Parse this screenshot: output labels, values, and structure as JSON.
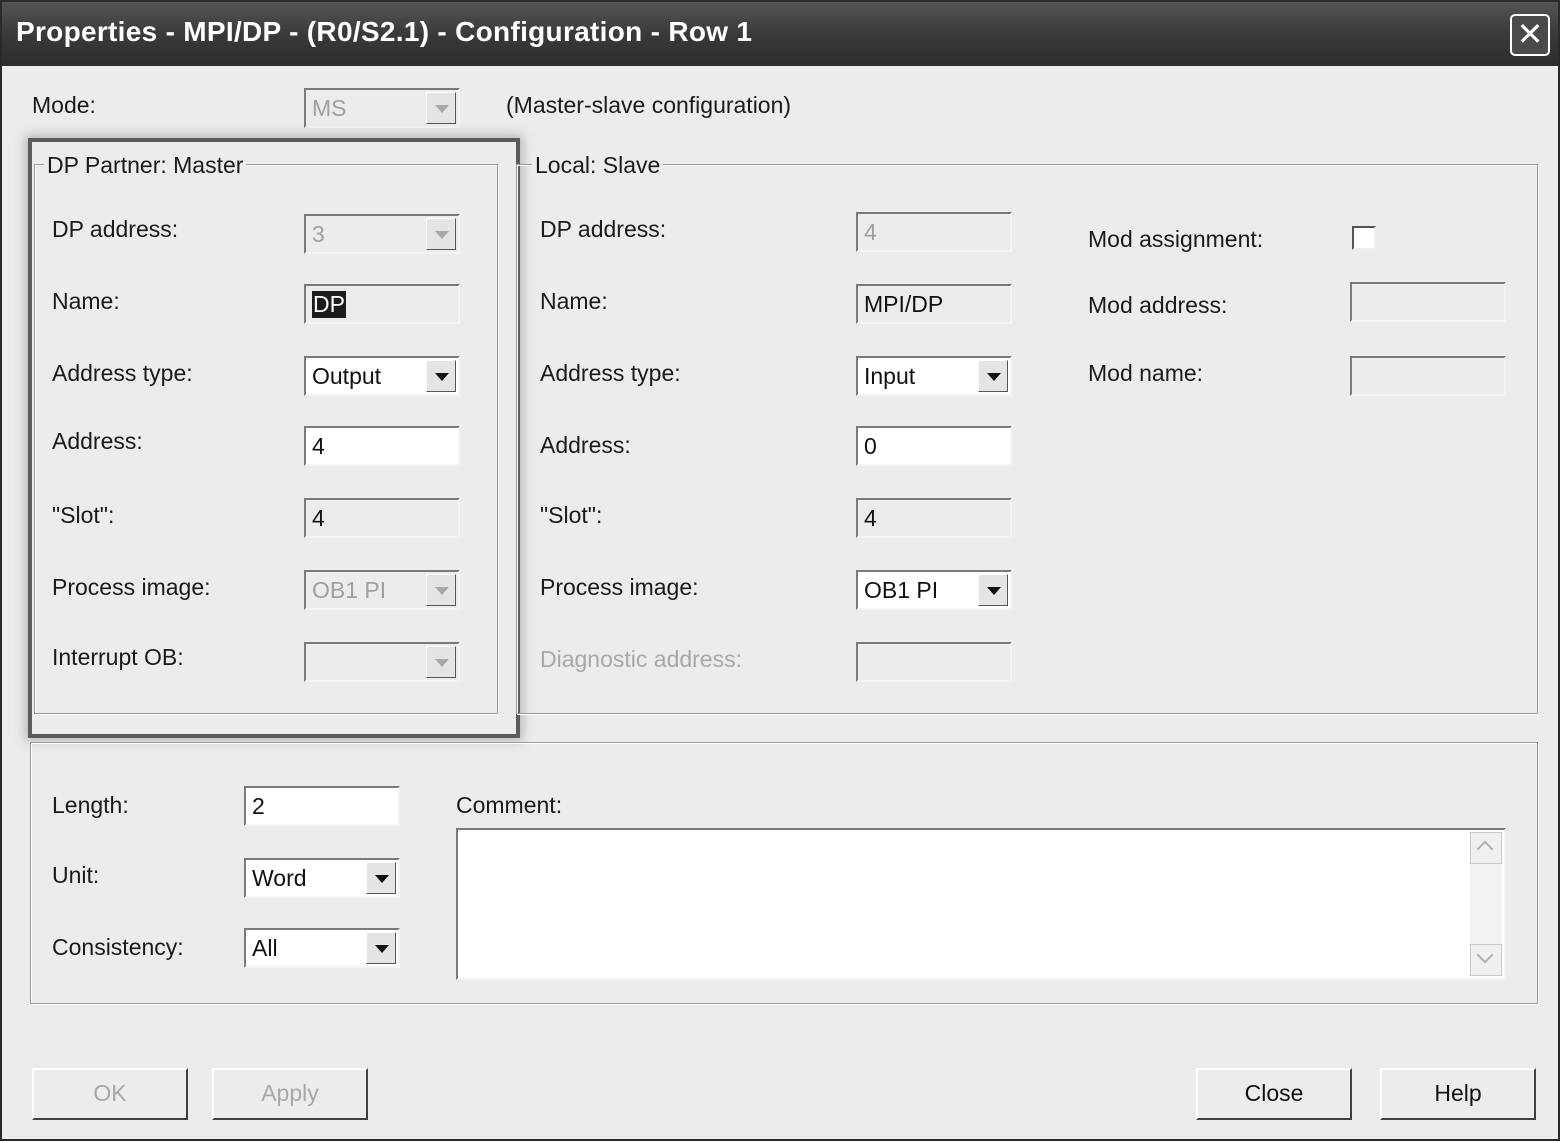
{
  "window": {
    "title": "Properties - MPI/DP - (R0/S2.1) - Configuration - Row 1",
    "close_glyph": "✕"
  },
  "mode": {
    "label": "Mode:",
    "value": "MS",
    "description": "(Master-slave configuration)"
  },
  "dp_partner": {
    "group_title": "DP Partner: Master",
    "dp_address_label": "DP address:",
    "dp_address_value": "3",
    "name_label": "Name:",
    "name_value": "DP",
    "address_type_label": "Address type:",
    "address_type_value": "Output",
    "address_label": "Address:",
    "address_value": "4",
    "slot_label": "\"Slot\":",
    "slot_value": "4",
    "process_image_label": "Process image:",
    "process_image_value": "OB1 PI",
    "interrupt_ob_label": "Interrupt OB:",
    "interrupt_ob_value": ""
  },
  "local": {
    "group_title": "Local: Slave",
    "dp_address_label": "DP address:",
    "dp_address_value": "4",
    "name_label": "Name:",
    "name_value": "MPI/DP",
    "address_type_label": "Address type:",
    "address_type_value": "Input",
    "address_label": "Address:",
    "address_value": "0",
    "slot_label": "\"Slot\":",
    "slot_value": "4",
    "process_image_label": "Process image:",
    "process_image_value": "OB1 PI",
    "diagnostic_address_label": "Diagnostic address:",
    "diagnostic_address_value": "",
    "mod_assignment_label": "Mod assignment:",
    "mod_assignment_checked": false,
    "mod_address_label": "Mod address:",
    "mod_address_value": "",
    "mod_name_label": "Mod name:",
    "mod_name_value": ""
  },
  "bottom": {
    "length_label": "Length:",
    "length_value": "2",
    "unit_label": "Unit:",
    "unit_value": "Word",
    "consistency_label": "Consistency:",
    "consistency_value": "All",
    "comment_label": "Comment:",
    "comment_value": ""
  },
  "buttons": {
    "ok": "OK",
    "apply": "Apply",
    "close": "Close",
    "help": "Help"
  },
  "colors": {
    "titlebar": "#3a3a3a",
    "dialog_bg": "#ececec",
    "highlight_frame": "#5c5c5c"
  }
}
